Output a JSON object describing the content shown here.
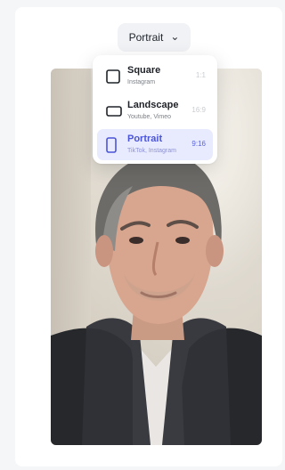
{
  "toolbar": {
    "selected_ratio_label": "Portrait",
    "chevron_icon": "chevron-down-icon"
  },
  "dropdown": {
    "options": [
      {
        "title": "Square",
        "subtitle": "Instagram",
        "ratio": "1:1",
        "icon": "square-icon",
        "selected": false
      },
      {
        "title": "Landscape",
        "subtitle": "Youtube, Vimeo",
        "ratio": "16:9",
        "icon": "landscape-icon",
        "selected": false
      },
      {
        "title": "Portrait",
        "subtitle": "TikTok, Instagram",
        "ratio": "9:16",
        "icon": "portrait-icon",
        "selected": true
      }
    ]
  },
  "colors": {
    "accent": "#4a55d8",
    "selected_background": "#e8eafe"
  }
}
